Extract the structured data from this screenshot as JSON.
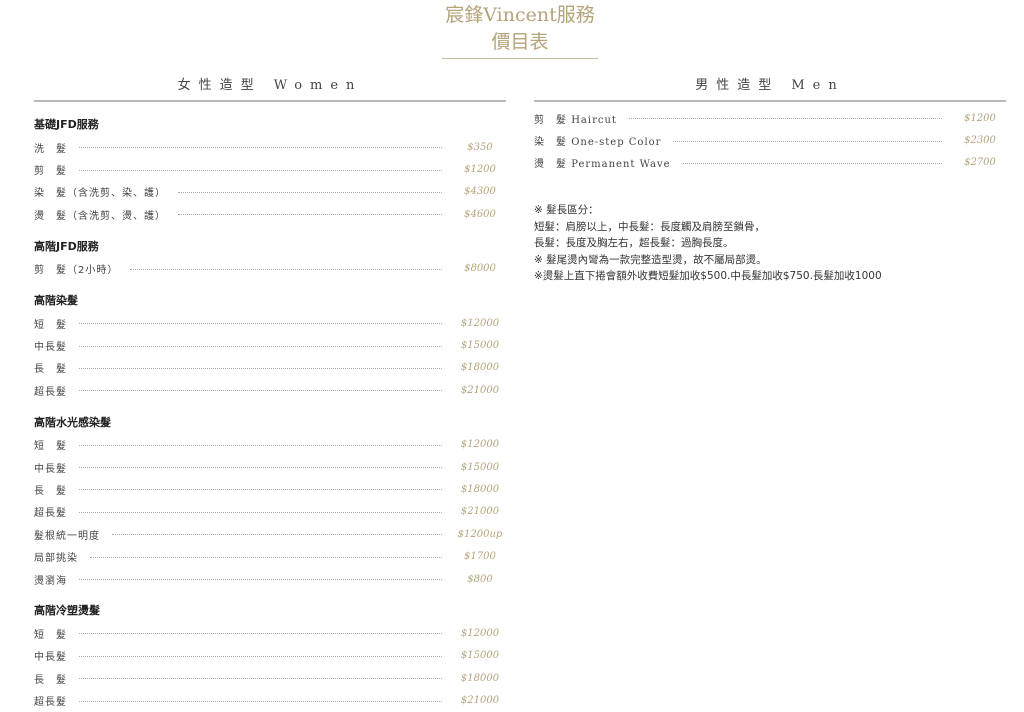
{
  "title": {
    "line1": "宸鋒Vincent服務",
    "line2": "價目表"
  },
  "women": {
    "heading": "女性造型 Women",
    "groups": [
      {
        "title": "基礎JFD服務",
        "items": [
          {
            "name": "洗　髮",
            "price": "$350"
          },
          {
            "name": "剪　髮",
            "price": "$1200"
          },
          {
            "name": "染　髮（含洗剪、染、護）",
            "price": "$4300"
          },
          {
            "name": "燙　髮（含洗剪、燙、護）",
            "price": "$4600"
          }
        ]
      },
      {
        "title": "高階JFD服務",
        "items": [
          {
            "name": "剪　髮（2小時）",
            "price": "$8000"
          }
        ]
      },
      {
        "title": "高階染髮",
        "items": [
          {
            "name": "短　髮",
            "price": "$12000"
          },
          {
            "name": "中長髮",
            "price": "$15000"
          },
          {
            "name": "長　髮",
            "price": "$18000"
          },
          {
            "name": "超長髮",
            "price": "$21000"
          }
        ]
      },
      {
        "title": "高階水光感染髮",
        "items": [
          {
            "name": "短　髮",
            "price": "$12000"
          },
          {
            "name": "中長髮",
            "price": "$15000"
          },
          {
            "name": "長　髮",
            "price": "$18000"
          },
          {
            "name": "超長髮",
            "price": "$21000"
          },
          {
            "name": "髮根統一明度",
            "price": "$1200up"
          },
          {
            "name": "局部挑染",
            "price": "$1700"
          },
          {
            "name": "燙瀏海",
            "price": "$800"
          }
        ]
      },
      {
        "title": "高階冷塑燙髮",
        "items": [
          {
            "name": "短　髮",
            "price": "$12000"
          },
          {
            "name": "中長髮",
            "price": "$15000"
          },
          {
            "name": "長　髮",
            "price": "$18000"
          },
          {
            "name": "超長髮",
            "price": "$21000"
          }
        ]
      }
    ]
  },
  "men": {
    "heading": "男性造型 Men",
    "items": [
      {
        "name": "剪　髮",
        "en": "Haircut",
        "price": "$1200"
      },
      {
        "name": "染　髮",
        "en": "One-step Color",
        "price": "$2300"
      },
      {
        "name": "燙　髮",
        "en": "Permanent Wave",
        "price": "$2700"
      }
    ],
    "notes": [
      "※ 髮長區分：",
      "短髮：肩膀以上，中長髮：長度觸及肩膀至鎖骨，",
      "長髮：長度及胸左右，超長髮：過胸長度。",
      "※ 髮尾燙內彎為一款完整造型燙，故不屬局部燙。",
      "※燙髮上直下捲會額外收費短髮加收$500.中長髮加收$750.長髮加收1000"
    ]
  }
}
